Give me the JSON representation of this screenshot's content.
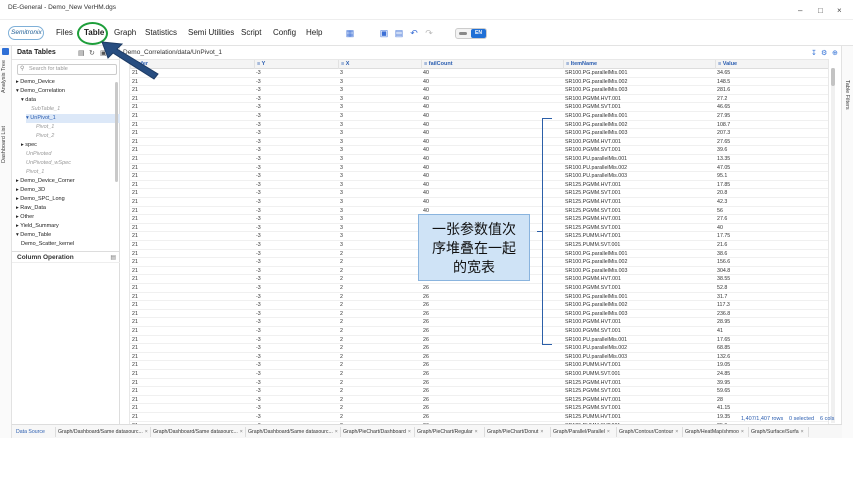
{
  "window": {
    "title": "DE-General - Demo_New VerHM.dgs",
    "min": "–",
    "max": "□",
    "close": "×"
  },
  "logo": "Semitronix",
  "menu": [
    "Files",
    "Table",
    "Graph",
    "Statistics",
    "Semi Utilities",
    "Script",
    "Config",
    "Help"
  ],
  "toggle_label": "EN",
  "left_strip": [
    "Analysis Tree",
    "Dashboard List"
  ],
  "right_strip": "Table Filters",
  "panel": {
    "title": "Data Tables",
    "search_placeholder": "Search for table",
    "tree": [
      {
        "label": "▸ Demo_Device",
        "indent": 0,
        "style": ""
      },
      {
        "label": "▾ Demo_Correlation",
        "indent": 0,
        "style": ""
      },
      {
        "label": "▾ data",
        "indent": 1,
        "style": ""
      },
      {
        "label": "SubTable_1",
        "indent": 3,
        "style": "dim"
      },
      {
        "label": "▾ UnPivot_1",
        "indent": 2,
        "style": "selected"
      },
      {
        "label": "Pivot_1",
        "indent": 4,
        "style": "dim"
      },
      {
        "label": "Pivot_2",
        "indent": 4,
        "style": "dim"
      },
      {
        "label": "▸ spec",
        "indent": 1,
        "style": ""
      },
      {
        "label": "UnPivoted",
        "indent": 2,
        "style": "dim"
      },
      {
        "label": "UnPivoted_wSpec",
        "indent": 2,
        "style": "dim"
      },
      {
        "label": "Pivot_1",
        "indent": 2,
        "style": "dim"
      },
      {
        "label": "▸ Demo_Device_Corner",
        "indent": 0,
        "style": ""
      },
      {
        "label": "▸ Demo_3D",
        "indent": 0,
        "style": ""
      },
      {
        "label": "▸ Demo_SPC_Long",
        "indent": 0,
        "style": ""
      },
      {
        "label": "▸ Raw_Data",
        "indent": 0,
        "style": ""
      },
      {
        "label": "▸ Other",
        "indent": 0,
        "style": ""
      },
      {
        "label": "▸ Yield_Summary",
        "indent": 0,
        "style": ""
      },
      {
        "label": "▾ Demo_Table",
        "indent": 0,
        "style": ""
      },
      {
        "label": "Demo_Scatter_kernel",
        "indent": 1,
        "style": ""
      }
    ],
    "column_operation": "Column Operation"
  },
  "main": {
    "breadcrumb": "Demo_Correlation/data/UnPivot_1",
    "columns": [
      "Wafer",
      "Y",
      "X",
      "failCount",
      "ItemName",
      "Value"
    ],
    "rows": [
      [
        "21",
        "-3",
        "3",
        "40",
        "SR100.PG.parallelMis.001",
        "34.65"
      ],
      [
        "21",
        "-3",
        "3",
        "40",
        "SR100.PG.parallelMis.002",
        "148.5"
      ],
      [
        "21",
        "-3",
        "3",
        "40",
        "SR100.PG.parallelMis.003",
        "281.6"
      ],
      [
        "21",
        "-3",
        "3",
        "40",
        "SR100.PGMM.HVT.001",
        "27.2"
      ],
      [
        "21",
        "-3",
        "3",
        "40",
        "SR100.PGMM.SVT.001",
        "46.65"
      ],
      [
        "21",
        "-3",
        "3",
        "40",
        "SR100.PG.parallelMis.001",
        "27.95"
      ],
      [
        "21",
        "-3",
        "3",
        "40",
        "SR100.PG.parallelMis.002",
        "108.7"
      ],
      [
        "21",
        "-3",
        "3",
        "40",
        "SR100.PG.parallelMis.003",
        "207.3"
      ],
      [
        "21",
        "-3",
        "3",
        "40",
        "SR100.PGMM.HVT.001",
        "27.65"
      ],
      [
        "21",
        "-3",
        "3",
        "40",
        "SR100.PGMM.SVT.001",
        "39.6"
      ],
      [
        "21",
        "-3",
        "3",
        "40",
        "SR100.PU.parallelMis.001",
        "13.35"
      ],
      [
        "21",
        "-3",
        "3",
        "40",
        "SR100.PU.parallelMis.002",
        "47.05"
      ],
      [
        "21",
        "-3",
        "3",
        "40",
        "SR100.PU.parallelMis.003",
        "95.1"
      ],
      [
        "21",
        "-3",
        "3",
        "40",
        "SR125.PGMM.HVT.001",
        "17.85"
      ],
      [
        "21",
        "-3",
        "3",
        "40",
        "SR125.PGMM.SVT.001",
        "20.8"
      ],
      [
        "21",
        "-3",
        "3",
        "40",
        "SR125.PGMM.HVT.001",
        "42.3"
      ],
      [
        "21",
        "-3",
        "3",
        "40",
        "SR125.PGMM.SVT.001",
        "56"
      ],
      [
        "21",
        "-3",
        "3",
        "40",
        "SR125.PGMM.HVT.001",
        "27.6"
      ],
      [
        "21",
        "-3",
        "3",
        "40",
        "SR125.PGMM.SVT.001",
        "40"
      ],
      [
        "21",
        "-3",
        "3",
        "40",
        "SR125.PUMM.HVT.001",
        "17.75"
      ],
      [
        "21",
        "-3",
        "3",
        "40",
        "SR125.PUMM.SVT.001",
        "21.6"
      ],
      [
        "21",
        "-3",
        "2",
        "26",
        "SR100.PG.parallelMis.001",
        "38.6"
      ],
      [
        "21",
        "-3",
        "2",
        "26",
        "SR100.PG.parallelMis.002",
        "156.6"
      ],
      [
        "21",
        "-3",
        "2",
        "26",
        "SR100.PG.parallelMis.003",
        "304.8"
      ],
      [
        "21",
        "-3",
        "2",
        "26",
        "SR100.PGMM.HVT.001",
        "38.55"
      ],
      [
        "21",
        "-3",
        "2",
        "26",
        "SR100.PGMM.SVT.001",
        "52.8"
      ],
      [
        "21",
        "-3",
        "2",
        "26",
        "SR100.PG.parallelMis.001",
        "31.7"
      ],
      [
        "21",
        "-3",
        "2",
        "26",
        "SR100.PG.parallelMis.002",
        "117.3"
      ],
      [
        "21",
        "-3",
        "2",
        "26",
        "SR100.PG.parallelMis.003",
        "236.8"
      ],
      [
        "21",
        "-3",
        "2",
        "26",
        "SR100.PGMM.HVT.001",
        "28.95"
      ],
      [
        "21",
        "-3",
        "2",
        "26",
        "SR100.PGMM.SVT.001",
        "41"
      ],
      [
        "21",
        "-3",
        "2",
        "26",
        "SR100.PU.parallelMis.001",
        "17.65"
      ],
      [
        "21",
        "-3",
        "2",
        "26",
        "SR100.PU.parallelMis.002",
        "68.85"
      ],
      [
        "21",
        "-3",
        "2",
        "26",
        "SR100.PU.parallelMis.003",
        "132.6"
      ],
      [
        "21",
        "-3",
        "2",
        "26",
        "SR100.PUMM.HVT.001",
        "19.05"
      ],
      [
        "21",
        "-3",
        "2",
        "26",
        "SR100.PUMM.SVT.001",
        "24.85"
      ],
      [
        "21",
        "-3",
        "2",
        "26",
        "SR125.PGMM.HVT.001",
        "39.95"
      ],
      [
        "21",
        "-3",
        "2",
        "26",
        "SR125.PGMM.SVT.001",
        "59.65"
      ],
      [
        "21",
        "-3",
        "2",
        "26",
        "SR125.PGMM.HVT.001",
        "28"
      ],
      [
        "21",
        "-3",
        "2",
        "26",
        "SR125.PGMM.SVT.001",
        "41.15"
      ],
      [
        "21",
        "-3",
        "2",
        "26",
        "SR125.PUMM.HVT.001",
        "19.35"
      ],
      [
        "21",
        "-3",
        "2",
        "26",
        "SR125.PUMM.SVT.001",
        "25.9"
      ]
    ],
    "row_count": "1,407/1,407 rows",
    "selected": "0 selected",
    "cols": "6 cols"
  },
  "annotation": {
    "line1": "一张参数值次",
    "line2": "序堆叠在一起",
    "line3": "的宽表"
  },
  "bottom_tabs": [
    "Data Source",
    "Graph/Dashboard/Same datasourc...",
    "Graph/Dashboard/Same datasourc...",
    "Graph/Dashboard/Same datasourc...",
    "Graph/PieChart/Dashboard",
    "Graph/PieChart/Regular",
    "Graph/PieChart/Donut",
    "Graph/Parallel/Parallel",
    "Graph/Contour/Contour",
    "Graph/HeatMap/shmoo",
    "Graph/Surface/Surfa"
  ],
  "colors": {
    "accent": "#2a5db0",
    "highlight_ring": "#1e9e3a",
    "callout_bg": "#cfe3f6"
  }
}
